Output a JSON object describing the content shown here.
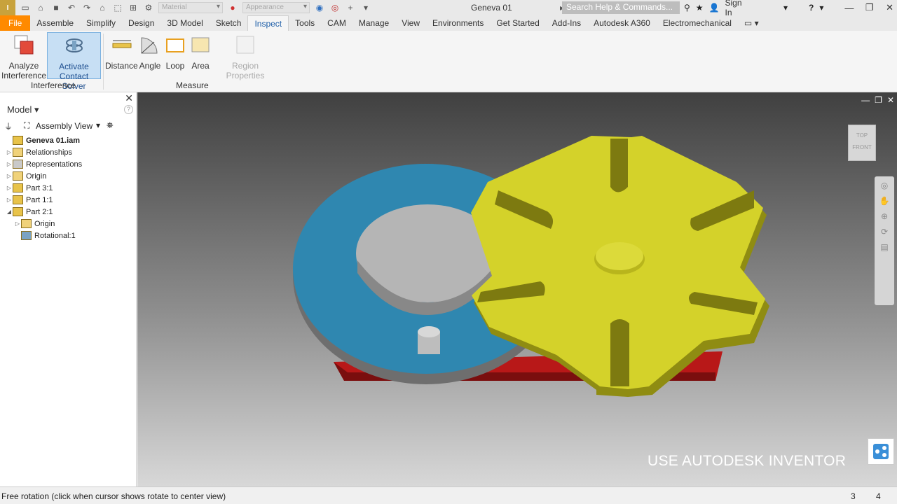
{
  "titlebar": {
    "logo_text": "I",
    "material_combo": "Material",
    "appearance_combo": "Appearance",
    "document_title": "Geneva 01",
    "search_placeholder": "Search Help & Commands...",
    "signin_label": "Sign In",
    "help_label": "?"
  },
  "tabs": [
    "File",
    "Assemble",
    "Simplify",
    "Design",
    "3D Model",
    "Sketch",
    "Inspect",
    "Tools",
    "CAM",
    "Manage",
    "View",
    "Environments",
    "Get Started",
    "Add-Ins",
    "Autodesk A360",
    "Electromechanical"
  ],
  "active_tab": "Inspect",
  "ribbon": {
    "analyze_interference": "Analyze Interference",
    "analyze_line1": "Analyze",
    "analyze_line2": "Interference",
    "contact_line1": "Activate",
    "contact_line2": "Contact Solver",
    "distance": "Distance",
    "angle": "Angle",
    "loop": "Loop",
    "area": "Area",
    "region_properties": "Region Properties",
    "group_interference": "Interference",
    "group_measure": "Measure"
  },
  "browser": {
    "title": "Model",
    "view_label": "Assembly View",
    "close": "✕",
    "help": "?",
    "tree": [
      {
        "label": "Geneva 01.iam",
        "indent": 0,
        "toggle": "",
        "icon": "assembly-icon",
        "bold": true
      },
      {
        "label": "Relationships",
        "indent": 0,
        "toggle": "▷",
        "icon": "folder-icon",
        "bold": false
      },
      {
        "label": "Representations",
        "indent": 0,
        "toggle": "▷",
        "icon": "representations-icon",
        "bold": false
      },
      {
        "label": "Origin",
        "indent": 0,
        "toggle": "▷",
        "icon": "folder-icon",
        "bold": false
      },
      {
        "label": "Part 3:1",
        "indent": 0,
        "toggle": "▷",
        "icon": "part-grounded-icon",
        "bold": false
      },
      {
        "label": "Part 1:1",
        "indent": 0,
        "toggle": "▷",
        "icon": "part-joint-icon",
        "bold": false
      },
      {
        "label": "Part 2:1",
        "indent": 0,
        "toggle": "◢",
        "icon": "part-joint-icon",
        "bold": false
      },
      {
        "label": "Origin",
        "indent": 1,
        "toggle": "▷",
        "icon": "folder-icon",
        "bold": false
      },
      {
        "label": "Rotational:1",
        "indent": 1,
        "toggle": "",
        "icon": "joint-icon",
        "bold": false
      }
    ]
  },
  "viewport": {
    "viewcube_top": "TOP",
    "viewcube_front": "FRONT",
    "watermark": "USE AUTODESK INVENTOR",
    "colors": {
      "disc": "#2f87b0",
      "star": "#d4d22a",
      "base": "#b81818",
      "pin": "#c8c8c8"
    }
  },
  "statusbar": {
    "text": "Free rotation (click when cursor shows rotate to center view)",
    "count1": "3",
    "count2": "4"
  }
}
